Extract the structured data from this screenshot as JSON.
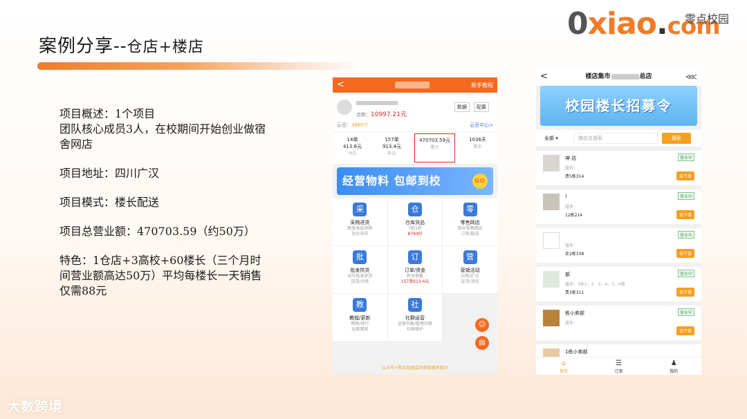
{
  "slide": {
    "title_main": "案例分享--",
    "title_sub": "仓店+楼店",
    "logo": {
      "brand_o": "0",
      "brand_xiao": "xiao",
      "brand_dot": ".",
      "brand_com": "com",
      "brand_cn": "零点校园"
    },
    "footer_logo": "大数跨境"
  },
  "content": {
    "overview": "项目概述：1个项目",
    "team": "团队核心成员3人，在校期间开始创业做宿舍网店",
    "address": "项目地址：四川广汉",
    "mode": "项目模式：楼长配送",
    "revenue": "项目总营业额：470703.59（约50万）",
    "feature": "特色：1仓店+3高校+60楼长（三个月时间营业额高达50万）平均每楼长一天销售仅需88元"
  },
  "phone1": {
    "header_back": "<",
    "header_right": "新手教程",
    "balance_label": "余额：",
    "balance": "10997.21元",
    "btn_data": "数据",
    "btn_config": "配置",
    "cloud_label": "云豆：",
    "coins": "3880个",
    "cloud_center": "云豆中心>",
    "stats": [
      {
        "top": "14单",
        "mid": "413.8元",
        "small": "今日"
      },
      {
        "top": "157单",
        "mid": "913.4元",
        "small": "昨日"
      },
      {
        "top": "470703.59元",
        "mid": "",
        "small": "累计"
      },
      {
        "top": "1036天",
        "mid": "",
        "small": "剩余"
      }
    ],
    "banner": "经营物料  包邮到校",
    "banner_go": "GO",
    "grid": [
      {
        "icon": "采",
        "label": "采购进货",
        "desc1": "新款食品采购",
        "desc2": "优价多样"
      },
      {
        "icon": "仓",
        "label": "仓库货品",
        "desc1": "7款1样",
        "desc2": "8794份"
      },
      {
        "icon": "零",
        "label": "零售网店",
        "desc1": "楼长零售网店",
        "desc2": "订单/配送"
      },
      {
        "icon": "批",
        "label": "批发供货",
        "desc1": "对外批发供货",
        "desc2": "送货/分拣"
      },
      {
        "icon": "订",
        "label": "订单/资金",
        "desc1": "昨日销量",
        "desc2": "157单913.4元"
      },
      {
        "icon": "营",
        "label": "营销活动",
        "desc1": "拉新/扩点",
        "desc2": "促活/消化"
      },
      {
        "icon": "教",
        "label": "教程/更新",
        "desc1": "帮助/排行",
        "desc2": "运营案例"
      },
      {
        "icon": "社",
        "label": "社群运营",
        "desc1": "运营社群/管理社群",
        "desc2": "社群维护"
      }
    ],
    "bottom_text": "公众号+购买校园会员获取相关知识"
  },
  "phone2": {
    "header_back": "<",
    "header_title": "楼店集市",
    "header_suffix": "总店",
    "banner": "校园楼长招募令",
    "filter_all": "全部",
    "search_placeholder": "楼店名搜索",
    "search_btn": "搜索",
    "cards": [
      {
        "name": "神     店",
        "srv": "服务：",
        "addr": "贵5栋314",
        "status": "营业中",
        "action": "去下单"
      },
      {
        "name": "        )",
        "srv": "服务：",
        "addr": "12栋214",
        "status": "营业中",
        "action": "去下单"
      },
      {
        "name": "        ",
        "srv": "服务：",
        "addr": "女2栋338",
        "status": "营业中",
        "action": "去下单"
      },
      {
        "name": "       部",
        "srv": "服务：3栋1、2、3、4、5、6楼",
        "addr": "贵3栋311",
        "status": "营业中",
        "action": "去下单"
      },
      {
        "name": "    栋小卖部",
        "srv": "服务：",
        "addr": "",
        "status": "营业中",
        "action": "去下单"
      },
      {
        "name": "    1栋小卖部",
        "srv": "",
        "addr": "",
        "status": "",
        "action": ""
      }
    ],
    "tabs": [
      {
        "icon": "⌂",
        "label": "首页"
      },
      {
        "icon": "☰",
        "label": "订单"
      },
      {
        "icon": "♟",
        "label": "我的"
      }
    ]
  }
}
